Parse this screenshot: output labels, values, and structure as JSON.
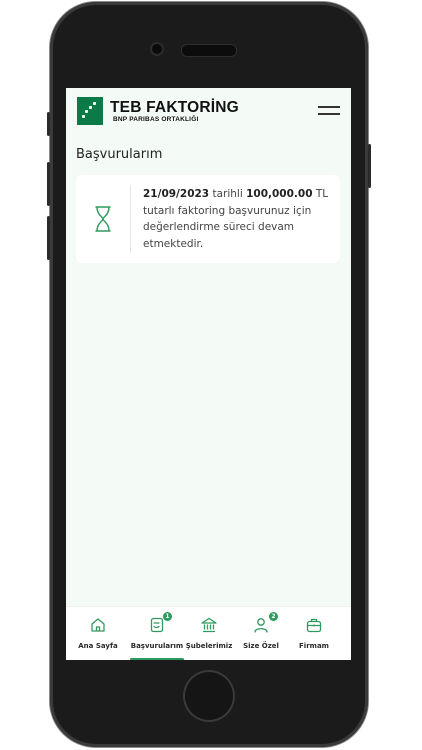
{
  "header": {
    "brand": "TEB FAKTORİNG",
    "brand_sub": "BNP PARIBAS ORTAKLIĞI",
    "menu_icon": "hamburger-icon"
  },
  "page": {
    "title": "Başvurularım"
  },
  "application": {
    "date": "21/09/2023",
    "date_word": " tarihli ",
    "amount": "100,000.00",
    "message": " TL tutarlı faktoring başvurunuz için değerlendirme süreci devam etmektedir.",
    "status_icon": "hourglass-icon"
  },
  "tabbar": {
    "active_color": "#2f9a5d",
    "tabs": [
      {
        "label": "Ana Sayfa",
        "icon": "home-icon"
      },
      {
        "label": "Başvurularım",
        "icon": "document-icon",
        "badge": "1"
      },
      {
        "label": "Şubelerimiz",
        "icon": "bank-icon"
      },
      {
        "label": "Size Özel",
        "icon": "user-icon",
        "badge": "2"
      },
      {
        "label": "Firmam",
        "icon": "briefcase-icon"
      }
    ]
  }
}
